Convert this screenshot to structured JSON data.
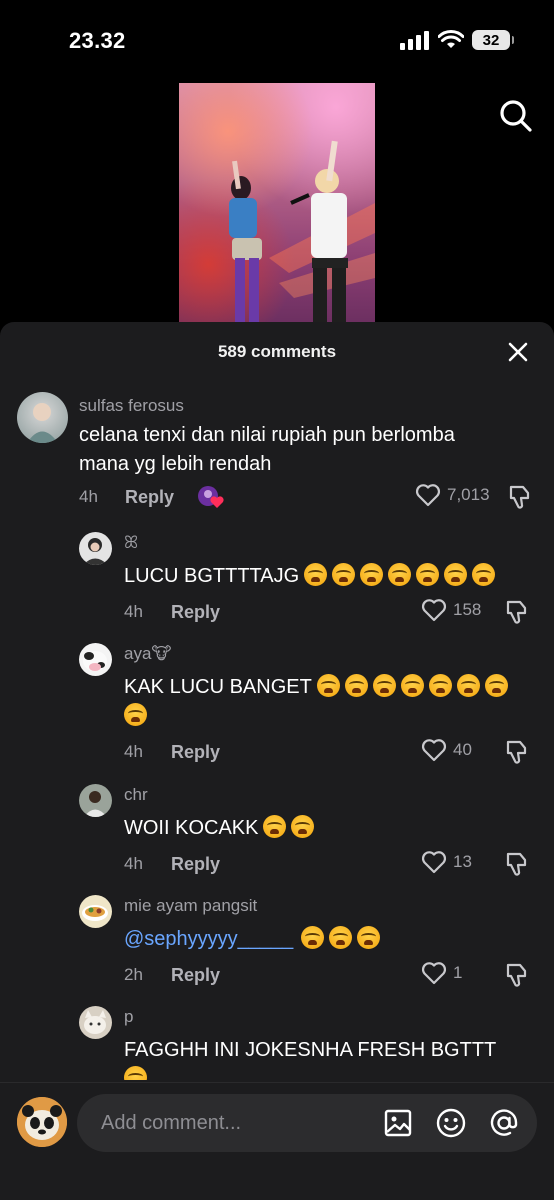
{
  "status_bar": {
    "time": "23.32",
    "battery": "32"
  },
  "video": {
    "description": "concert-video-thumbnail"
  },
  "panel": {
    "title": "589 comments"
  },
  "comments": [
    {
      "user": "sulfas ferosus",
      "text_lines": [
        "celana tenxi dan nilai rupiah pun berlomba",
        "mana yg lebih rendah"
      ],
      "time": "4h",
      "reply": "Reply",
      "likes": "7,013",
      "has_creator_like": true
    },
    {
      "user": "ꕤ",
      "text": "LUCU BGTTTTAJG",
      "emojis": 7,
      "time": "4h",
      "reply": "Reply",
      "likes": "158"
    },
    {
      "user": "aya🐮",
      "text": "KAK LUCU BANGET",
      "emojis": 7,
      "emojis_line2": 1,
      "time": "4h",
      "reply": "Reply",
      "likes": "40"
    },
    {
      "user": "chr",
      "text": "WOII KOCAKK",
      "emojis": 2,
      "time": "4h",
      "reply": "Reply",
      "likes": "13"
    },
    {
      "user": "mie ayam pangsit",
      "mention": "@sephyyyyy_____",
      "emojis": 3,
      "time": "2h",
      "reply": "Reply",
      "likes": "1"
    },
    {
      "user": "p",
      "text": "FAGGHH INI JOKESNHA FRESH BGTTT",
      "emojis_line2": 1
    }
  ],
  "input": {
    "placeholder": "Add comment..."
  },
  "icons": {
    "search": "search-icon",
    "close": "close-icon",
    "heart": "heart-icon",
    "dislike": "dislike-icon",
    "image": "image-icon",
    "emoji": "emoji-icon",
    "at": "at-icon"
  },
  "colors": {
    "panel_bg": "#1c1c1e",
    "mention": "#6aa6ff",
    "muted": "#a0a0a6"
  }
}
